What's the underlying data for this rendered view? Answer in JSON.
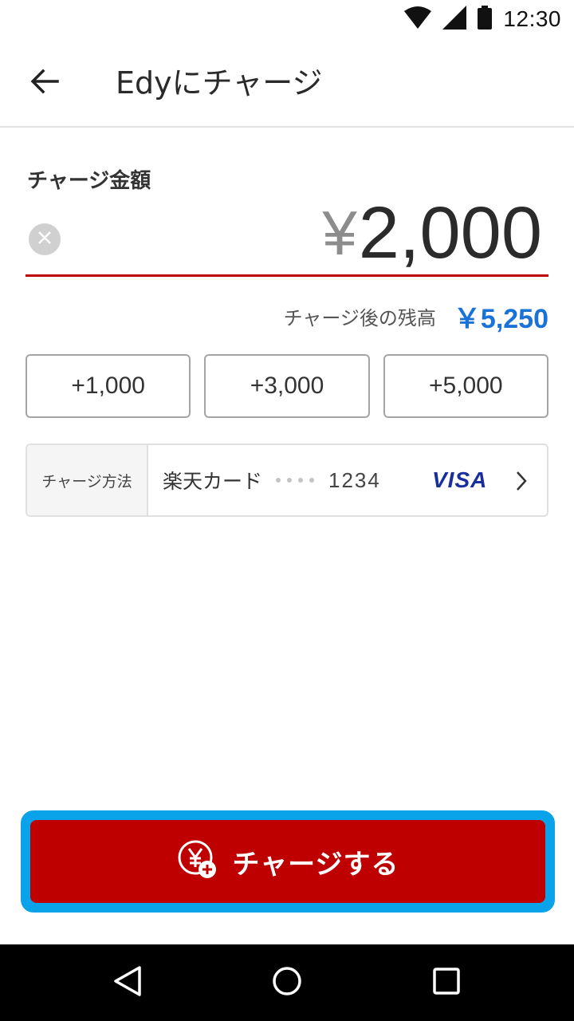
{
  "status_bar": {
    "time": "12:30",
    "icons": [
      "wifi-icon",
      "signal-icon",
      "battery-icon"
    ]
  },
  "app_bar": {
    "back_icon": "arrow-back-icon",
    "title": "Edyにチャージ"
  },
  "amount": {
    "label": "チャージ金額",
    "currency_symbol": "¥",
    "value": "2,000",
    "clear_icon": "clear-icon"
  },
  "balance_after": {
    "label": "チャージ後の残高",
    "value": "￥5,250"
  },
  "quick_amounts": [
    "+1,000",
    "+3,000",
    "+5,000"
  ],
  "charge_method": {
    "label": "チャージ方法",
    "card_name": "楽天カード",
    "last4": "1234",
    "brand": "VISA",
    "chevron_icon": "chevron-right-icon"
  },
  "charge_button": {
    "label": "チャージする",
    "icon": "yen-plus-icon"
  },
  "colors": {
    "accent_red": "#bf0000",
    "balance_blue": "#1a72d8",
    "focus_ring": "#0aa2e8",
    "visa_blue": "#1a2f9c"
  },
  "nav_bar": {
    "icons": [
      "back-triangle-icon",
      "home-circle-icon",
      "recents-square-icon"
    ]
  }
}
